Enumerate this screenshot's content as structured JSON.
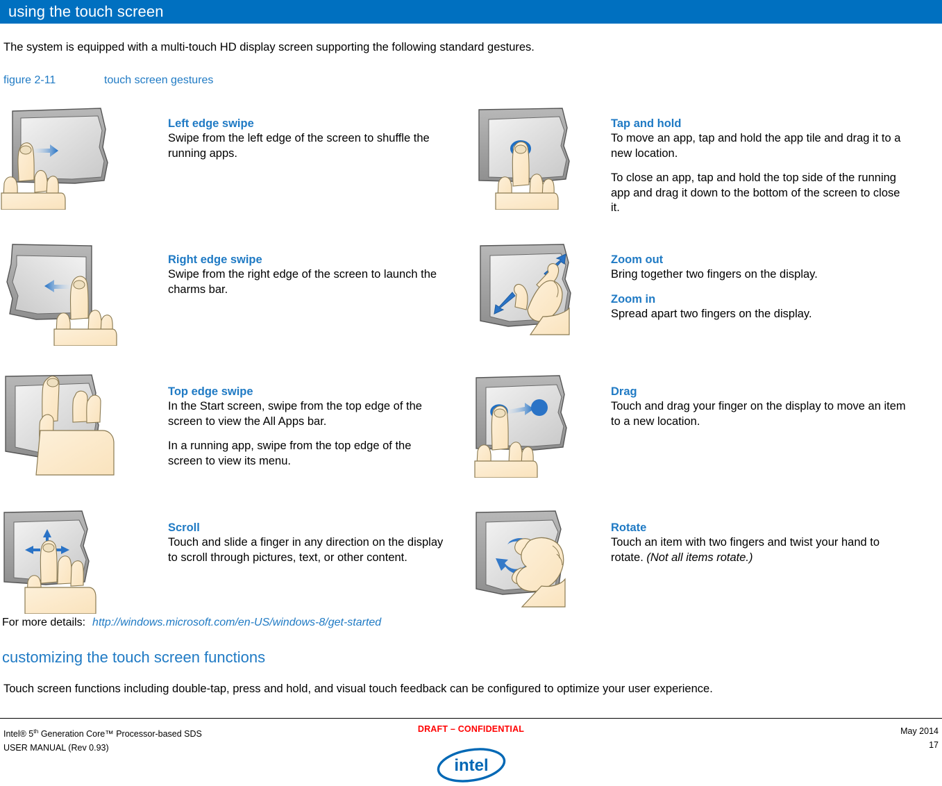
{
  "section": {
    "title": "using the touch screen",
    "bar_color": "#0070c0"
  },
  "intro": "The system is equipped with a multi-touch HD display screen supporting the following standard gestures.",
  "figure": {
    "number": "figure 2-11",
    "title": "touch screen gestures",
    "link_color": "#1f7ac4"
  },
  "gestures": [
    {
      "icon": "left-edge-swipe-icon",
      "title": "Left edge swipe",
      "paragraphs": [
        "Swipe from the left edge of the screen to shuffle the running apps."
      ]
    },
    {
      "icon": "tap-and-hold-icon",
      "title": "Tap and hold",
      "paragraphs": [
        "To move an app, tap and hold the app tile and drag it to a new location.",
        "To close an app, tap and hold the top side of the running app and drag it down to the bottom of the screen to close it."
      ]
    },
    {
      "icon": "right-edge-swipe-icon",
      "title": "Right edge swipe",
      "paragraphs": [
        "Swipe from the right edge of the screen to launch the charms bar."
      ]
    },
    {
      "icon": "zoom-pinch-icon",
      "title": "Zoom out",
      "paragraphs": [
        "Bring together two fingers on the display."
      ],
      "title2": "Zoom in",
      "paragraphs2": [
        "Spread apart two fingers on the display."
      ]
    },
    {
      "icon": "top-edge-swipe-icon",
      "title": "Top edge swipe",
      "paragraphs": [
        "In the Start screen, swipe from the top edge of the screen to view the All Apps bar.",
        "In a running app, swipe from the top edge of the screen to view its menu."
      ]
    },
    {
      "icon": "drag-icon",
      "title": "Drag",
      "paragraphs": [
        "Touch and drag your finger on the display to move an item to a new location."
      ]
    },
    {
      "icon": "scroll-icon",
      "title": "Scroll",
      "paragraphs": [
        "Touch and slide a finger in any direction on the display to scroll through pictures, text, or other content."
      ]
    },
    {
      "icon": "rotate-icon",
      "title": "Rotate",
      "paragraphs": [
        "Touch an item with two fingers and twist your hand to rotate. "
      ],
      "italic_tail": "(Not all items rotate.)"
    }
  ],
  "more_details": {
    "label": "For more details:",
    "url": "http://windows.microsoft.com/en-US/windows-8/get-started"
  },
  "sub_section": {
    "heading": "customizing the touch screen functions",
    "paragraph": "Touch screen functions including double-tap, press and hold, and visual touch feedback can be configured to optimize your user experience."
  },
  "footer": {
    "left_line1_pre": "Intel® 5",
    "left_line1_sup": "th",
    "left_line1_post": " Generation Core™ Processor-based SDS",
    "left_line2": "USER MANUAL (Rev 0.93)",
    "center": "DRAFT – CONFIDENTIAL",
    "center_color": "#ff0000",
    "right_line1": "May 2014",
    "right_line2": "17",
    "logo_text": "intel",
    "logo_color": "#0068b5"
  }
}
